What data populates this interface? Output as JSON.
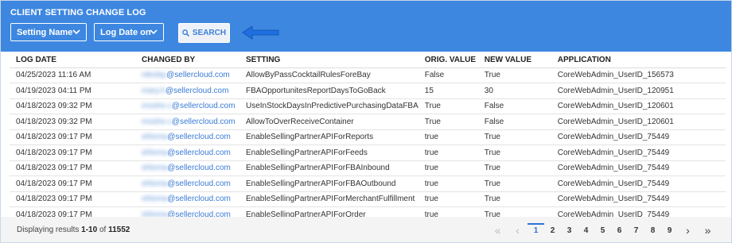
{
  "header": {
    "title": "CLIENT SETTING CHANGE LOG",
    "dropdown_setting_name": "Setting Name",
    "dropdown_log_date": "Log Date on",
    "search_label": "SEARCH"
  },
  "table": {
    "columns": [
      "LOG DATE",
      "CHANGED BY",
      "SETTING",
      "ORIG. VALUE",
      "NEW VALUE",
      "APPLICATION"
    ],
    "rows": [
      {
        "date": "04/25/2023 11:16 AM",
        "user_prefix": "nikolay",
        "user_domain": "@sellercloud.com",
        "setting": "AllowByPassCocktailRulesForeBay",
        "orig": "False",
        "new": "True",
        "app": "CoreWebAdmin_UserID_156573"
      },
      {
        "date": "04/19/2023 04:11 PM",
        "user_prefix": "mary.h",
        "user_domain": "@sellercloud.com",
        "setting": "FBAOpportunitesReportDaysToGoBack",
        "orig": "15",
        "new": "30",
        "app": "CoreWebAdmin_UserID_120951"
      },
      {
        "date": "04/18/2023 09:32 PM",
        "user_prefix": "moshe.c",
        "user_domain": "@sellercloud.com",
        "setting": "UseInStockDaysInPredictivePurchasingDataFBA",
        "orig": "True",
        "new": "False",
        "app": "CoreWebAdmin_UserID_120601"
      },
      {
        "date": "04/18/2023 09:32 PM",
        "user_prefix": "moshe.c",
        "user_domain": "@sellercloud.com",
        "setting": "AllowToOverReceiveContainer",
        "orig": "True",
        "new": "False",
        "app": "CoreWebAdmin_UserID_120601"
      },
      {
        "date": "04/18/2023 09:17 PM",
        "user_prefix": "shloma",
        "user_domain": "@sellercloud.com",
        "setting": "EnableSellingPartnerAPIForReports",
        "orig": "true",
        "new": "True",
        "app": "CoreWebAdmin_UserID_75449"
      },
      {
        "date": "04/18/2023 09:17 PM",
        "user_prefix": "shloma",
        "user_domain": "@sellercloud.com",
        "setting": "EnableSellingPartnerAPIForFeeds",
        "orig": "true",
        "new": "True",
        "app": "CoreWebAdmin_UserID_75449"
      },
      {
        "date": "04/18/2023 09:17 PM",
        "user_prefix": "shloma",
        "user_domain": "@sellercloud.com",
        "setting": "EnableSellingPartnerAPIForFBAInbound",
        "orig": "true",
        "new": "True",
        "app": "CoreWebAdmin_UserID_75449"
      },
      {
        "date": "04/18/2023 09:17 PM",
        "user_prefix": "shloma",
        "user_domain": "@sellercloud.com",
        "setting": "EnableSellingPartnerAPIForFBAOutbound",
        "orig": "true",
        "new": "True",
        "app": "CoreWebAdmin_UserID_75449"
      },
      {
        "date": "04/18/2023 09:17 PM",
        "user_prefix": "shloma",
        "user_domain": "@sellercloud.com",
        "setting": "EnableSellingPartnerAPIForMerchantFulfillment",
        "orig": "true",
        "new": "True",
        "app": "CoreWebAdmin_UserID_75449"
      },
      {
        "date": "04/18/2023 09:17 PM",
        "user_prefix": "shloma",
        "user_domain": "@sellercloud.com",
        "setting": "EnableSellingPartnerAPIForOrder",
        "orig": "true",
        "new": "True",
        "app": "CoreWebAdmin_UserID_75449"
      }
    ]
  },
  "footer": {
    "summary_prefix": "Displaying results ",
    "summary_range": "1-10",
    "summary_of": " of ",
    "summary_total": "11552",
    "pages": [
      "1",
      "2",
      "3",
      "4",
      "5",
      "6",
      "7",
      "8",
      "9"
    ],
    "active_page": "1",
    "first_symbol": "«",
    "prev_symbol": "‹",
    "next_symbol": "›",
    "last_symbol": "»"
  },
  "colors": {
    "header_bg": "#3d87e0",
    "link_blue": "#3a7bd5",
    "arrow_blue": "#1f6fe0"
  },
  "icons": [
    "chevron-down-icon",
    "search-icon",
    "arrow-left-icon"
  ]
}
